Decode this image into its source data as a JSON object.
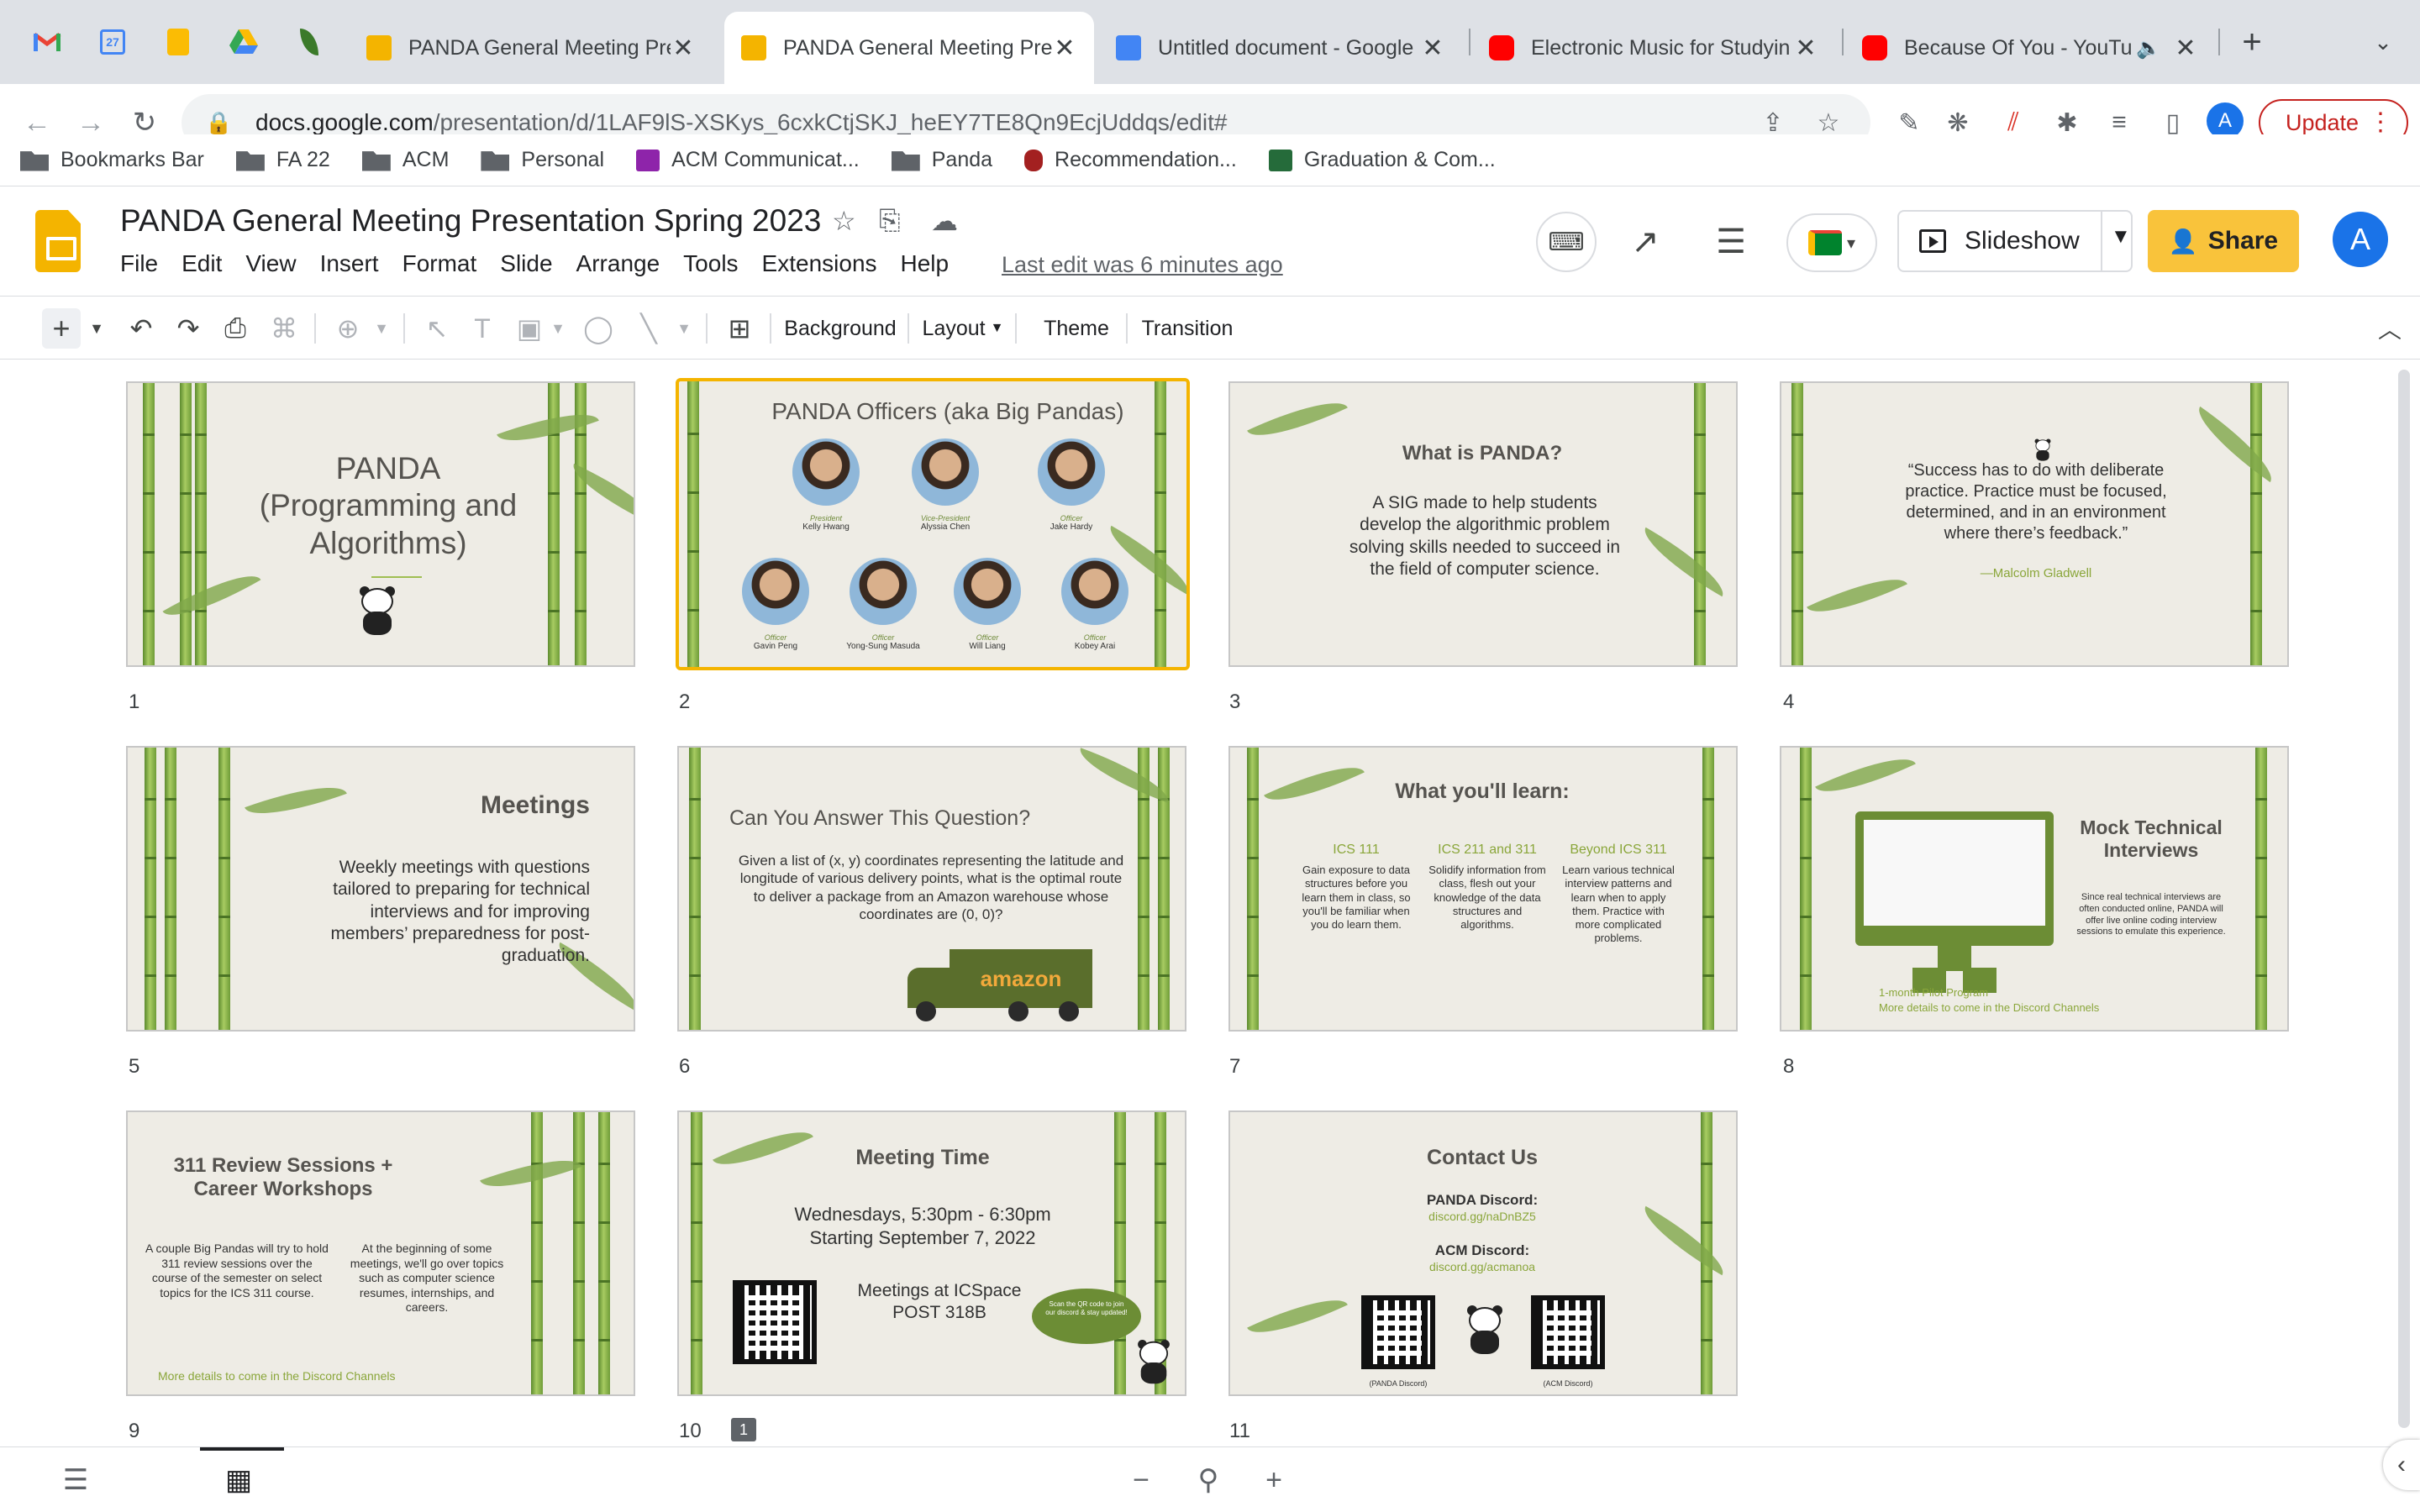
{
  "browser": {
    "tabs": [
      {
        "title": "PANDA General Meeting Pre",
        "type": "slides"
      },
      {
        "title": "PANDA General Meeting Pre",
        "type": "slides"
      },
      {
        "title": "Untitled document - Google",
        "type": "docs"
      },
      {
        "title": "Electronic Music for Studyin",
        "type": "youtube"
      },
      {
        "title": "Because Of You - YouTu",
        "type": "youtube"
      }
    ],
    "url_host": "docs.google.com",
    "url_path": "/presentation/d/1LAF9lS-XSKys_6cxkCtjSKJ_heEY7TE8Qn9EcjUddqs/edit#",
    "update_label": "Update",
    "profile_initial": "A",
    "bookmarks": [
      "Bookmarks Bar",
      "FA 22",
      "ACM",
      "Personal",
      "ACM Communicat...",
      "Panda",
      "Recommendation...",
      "Graduation & Com..."
    ],
    "colors": {
      "tabstrip": "#dee1e6",
      "update": "#c5221f",
      "accent": "#1a73e8"
    }
  },
  "app": {
    "title": "PANDA General Meeting Presentation Spring 2023",
    "menus": [
      "File",
      "Edit",
      "View",
      "Insert",
      "Format",
      "Slide",
      "Arrange",
      "Tools",
      "Extensions",
      "Help"
    ],
    "last_edit": "Last edit was 6 minutes ago",
    "slideshow_label": "Slideshow",
    "share_label": "Share",
    "avatar_initial": "A",
    "brand_color": "#f4b400"
  },
  "toolbar": {
    "background_label": "Background",
    "layout_label": "Layout",
    "theme_label": "Theme",
    "transition_label": "Transition"
  },
  "slides": [
    {
      "num": "1",
      "title": "PANDA (Programming and Algorithms)"
    },
    {
      "num": "2",
      "title": "PANDA Officers (aka Big Pandas)",
      "officers": [
        {
          "role": "President",
          "name": "Kelly Hwang"
        },
        {
          "role": "Vice-President",
          "name": "Alyssia Chen"
        },
        {
          "role": "Officer",
          "name": "Jake Hardy"
        },
        {
          "role": "Officer",
          "name": "Gavin Peng"
        },
        {
          "role": "Officer",
          "name": "Yong-Sung Masuda"
        },
        {
          "role": "Officer",
          "name": "Will Liang"
        },
        {
          "role": "Officer",
          "name": "Kobey Arai"
        }
      ]
    },
    {
      "num": "3",
      "title": "What is PANDA?",
      "body": "A SIG made to help students develop the algorithmic problem solving skills needed to succeed in the field of computer science."
    },
    {
      "num": "4",
      "quote": "“Success has to do with deliberate practice. Practice must be focused, determined, and in an environment where there’s feedback.”",
      "author": "—Malcolm Gladwell"
    },
    {
      "num": "5",
      "title": "Meetings",
      "body": "Weekly meetings with questions tailored to preparing for technical interviews and for improving members’ preparedness for post-graduation."
    },
    {
      "num": "6",
      "title": "Can You Answer This Question?",
      "body": "Given a list of (x, y) coordinates representing the latitude and longitude of various delivery points, what is the optimal route to deliver a package from an Amazon warehouse whose coordinates are (0, 0)?",
      "truck_text": "amazon"
    },
    {
      "num": "7",
      "title": "What you'll learn:",
      "columns": [
        {
          "head": "ICS 111",
          "text": "Gain exposure to data structures before you learn them in class, so you'll be familiar when you do learn them."
        },
        {
          "head": "ICS 211 and 311",
          "text": "Solidify information from class, flesh out your knowledge of the data structures and algorithms."
        },
        {
          "head": "Beyond ICS 311",
          "text": "Learn various technical interview patterns and learn when to apply them. Practice with more complicated problems."
        }
      ]
    },
    {
      "num": "8",
      "title": "Mock Technical Interviews",
      "body": "Since real technical interviews are often conducted online, PANDA will offer live online coding interview sessions to emulate this experience.",
      "footer1": "1-month Pilot Program",
      "footer2": "More details to come in the Discord Channels"
    },
    {
      "num": "9",
      "title": "311 Review Sessions + Career Workshops",
      "left": "A couple Big Pandas will try to hold 311 review sessions over the course of the semester on select topics for the ICS 311 course.",
      "right": "At the beginning of some meetings, we'll go over topics such as computer science resumes, internships, and careers.",
      "footer": "More details to come in the Discord Channels"
    },
    {
      "num": "10",
      "title": "Meeting Time",
      "line1": "Wednesdays, 5:30pm - 6:30pm",
      "line2": "Starting September 7, 2022",
      "line3": "Meetings at ICSpace",
      "line4": "POST 318B",
      "bubble": "Scan the QR code to join our discord & stay updated!",
      "comments": "1"
    },
    {
      "num": "11",
      "title": "Contact Us",
      "d1": "PANDA Discord:",
      "d1link": "discord.gg/naDnBZ5",
      "d2": "ACM Discord:",
      "d2link": "discord.gg/acmanoa",
      "qr1": "(PANDA Discord)",
      "qr2": "(ACM Discord)"
    }
  ]
}
